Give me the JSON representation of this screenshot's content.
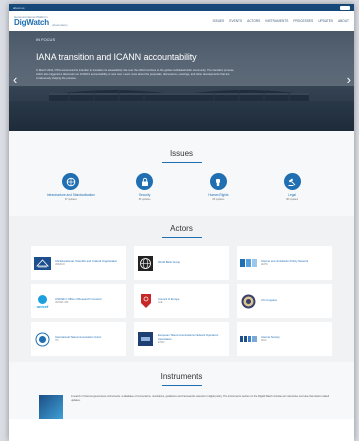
{
  "topbar": {
    "text": "about us"
  },
  "header": {
    "logo_top": "Geneva Internet Platform",
    "logo_main": "DigWatch",
    "logo_sub": "observatory",
    "nav": [
      "ISSUES",
      "EVENTS",
      "ACTORS",
      "INSTRUMENTS",
      "PROCESSES",
      "UPDATES",
      "ABOUT"
    ]
  },
  "hero": {
    "kicker": "IN FOCUS",
    "title": "IANA transition and ICANN accountability",
    "description": "In March 2014, NTIA announced its intention to transition its stewardship role over the IANA functions to the global multistakeholder community. The transition process, which also triggered a discussion on ICANN's accountability, is now over. Learn more about the proposals, discussions, meetings, and other developments that are continuously shaping the process."
  },
  "issues": {
    "title": "Issues",
    "items": [
      {
        "label": "Infrastructure and Standardisation",
        "count": "87 updates",
        "icon": "network-icon"
      },
      {
        "label": "Security",
        "count": "89 updates",
        "icon": "lock-icon"
      },
      {
        "label": "Human Rights",
        "count": "86 updates",
        "icon": "fist-icon"
      },
      {
        "label": "Legal",
        "count": "88 updates",
        "icon": "gavel-icon"
      }
    ]
  },
  "actors": {
    "title": "Actors",
    "items": [
      {
        "name": "UN Educational, Scientific and Cultural Organization",
        "acr": "UNESCO",
        "logo": "unesco-logo"
      },
      {
        "name": "World Bank Group",
        "acr": "",
        "logo": "worldbank-logo"
      },
      {
        "name": "Internet and Jurisdiction Policy Network",
        "acr": "I&JPN",
        "logo": "ijpn-logo"
      },
      {
        "name": "UNICEF's Office of Research Innocenti",
        "acr": "UNICEF ORI",
        "logo": "unicef-logo"
      },
      {
        "name": "Council of Europe",
        "acr": "CoE",
        "logo": "coe-logo"
      },
      {
        "name": "US Congress",
        "acr": "US Congress",
        "logo": "congress-logo"
      },
      {
        "name": "International Telecommunication Union",
        "acr": "ITU",
        "logo": "itu-logo"
      },
      {
        "name": "European Telecommunications Network Operators' Association",
        "acr": "ETNO",
        "logo": "etno-logo"
      },
      {
        "name": "Internet Society",
        "acr": "ISOC",
        "logo": "isoc-logo"
      }
    ]
  },
  "instruments": {
    "title": "Instruments",
    "text": "A search of Internet governance instruments: a database of conventions, resolutions, guidelines and frameworks relevant to digital policy. The instruments section on the Digital Watch includes an interactive overview that tracks related updates."
  },
  "colors": {
    "accent": "#1f6fb2",
    "topbar": "#16487a"
  }
}
